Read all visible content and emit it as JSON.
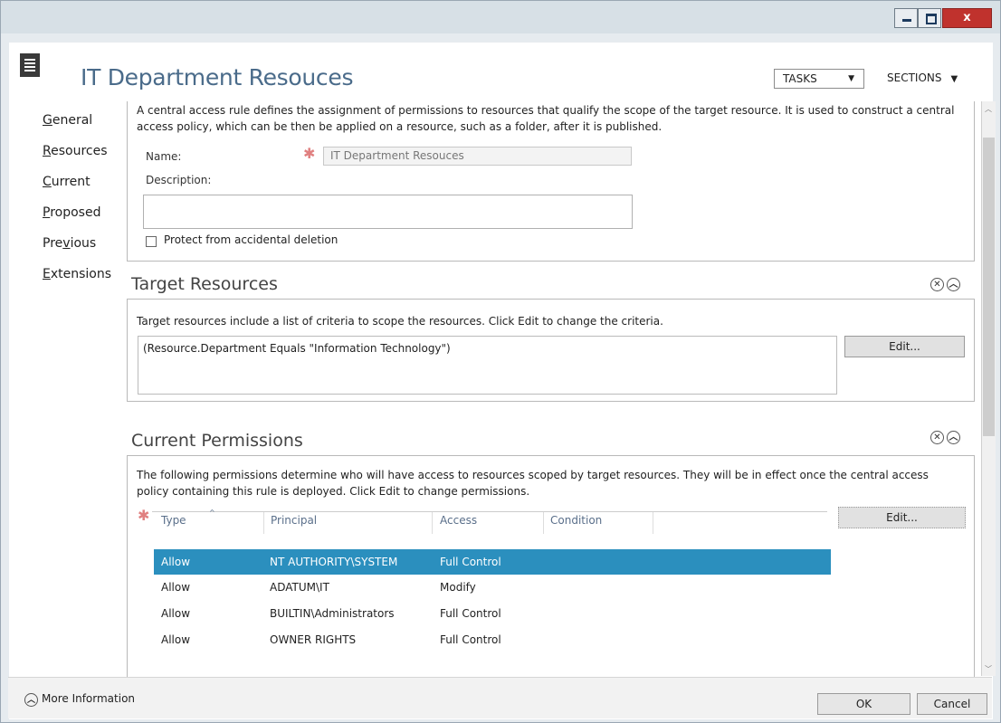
{
  "window": {
    "close_glyph": "x"
  },
  "header": {
    "title": "IT Department Resouces",
    "tasks_label": "TASKS",
    "sections_label": "SECTIONS"
  },
  "nav": {
    "items": [
      {
        "label": "General",
        "accesskey": "G"
      },
      {
        "label": "Resources",
        "accesskey": "R"
      },
      {
        "label": "Current",
        "accesskey": "C"
      },
      {
        "label": "Proposed",
        "accesskey": "P"
      },
      {
        "label": "Previous",
        "accesskey": "v"
      },
      {
        "label": "Extensions",
        "accesskey": "E"
      }
    ]
  },
  "general": {
    "intro": "A central access rule defines the assignment of permissions to resources that qualify the scope of the target resource. It is used to construct a central access policy, which can be then be applied on a resource, such as a folder, after it is published.",
    "name_label": "Name:",
    "name_value": "IT Department Resouces",
    "description_label": "Description:",
    "description_value": "",
    "protect_label": "Protect from accidental deletion",
    "protect_checked": false
  },
  "target": {
    "title": "Target Resources",
    "description": "Target resources include a list of criteria to scope the resources. Click Edit to change the criteria.",
    "criteria": "(Resource.Department Equals \"Information Technology\")",
    "edit_label": "Edit..."
  },
  "permissions": {
    "title": "Current Permissions",
    "description": "The following permissions determine who will have access to resources scoped by target resources. They will be in effect once the central access policy containing this rule is deployed. Click Edit to change permissions.",
    "edit_label": "Edit...",
    "columns": [
      "Type",
      "Principal",
      "Access",
      "Condition"
    ],
    "rows": [
      {
        "type": "Allow",
        "principal": "NT AUTHORITY\\SYSTEM",
        "access": "Full Control",
        "condition": "",
        "selected": true
      },
      {
        "type": "Allow",
        "principal": "ADATUM\\IT",
        "access": "Modify",
        "condition": "",
        "selected": false
      },
      {
        "type": "Allow",
        "principal": "BUILTIN\\Administrators",
        "access": "Full Control",
        "condition": "",
        "selected": false
      },
      {
        "type": "Allow",
        "principal": "OWNER RIGHTS",
        "access": "Full Control",
        "condition": "",
        "selected": false
      }
    ]
  },
  "footer": {
    "more_info": "More Information",
    "ok_label": "OK",
    "cancel_label": "Cancel"
  },
  "colors": {
    "title_text": "#4a6b8a",
    "selected_row": "#2b8fbe",
    "close_button": "#c0322d",
    "required_marker": "#e08080"
  }
}
